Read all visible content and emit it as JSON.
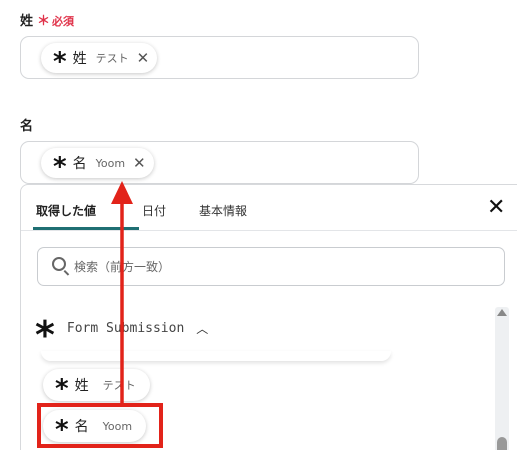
{
  "form": {
    "last_name": {
      "label": "姓",
      "required_mark": "＊",
      "required_text": "必須",
      "chip": {
        "icon": "asterisk-icon",
        "name": "姓",
        "value": "テスト"
      }
    },
    "first_name": {
      "label": "名",
      "chip": {
        "icon": "asterisk-icon",
        "name": "名",
        "value": "Yoom"
      }
    }
  },
  "dropdown": {
    "tabs": [
      {
        "label": "取得した値",
        "active": true
      },
      {
        "label": "日付",
        "active": false
      },
      {
        "label": "基本情報",
        "active": false
      }
    ],
    "search": {
      "placeholder": "検索（前方一致）",
      "value": ""
    },
    "group": {
      "icon": "asterisk-icon",
      "title": "Form Submission",
      "expanded": true
    },
    "items": [
      {
        "icon": "asterisk-icon",
        "name": "姓",
        "value": "テスト"
      },
      {
        "icon": "asterisk-icon",
        "name": "名",
        "value": "Yoom"
      }
    ]
  },
  "colors": {
    "required": "#e0334a",
    "tab_active_underline": "#1f6f73",
    "annotation": "#e2231a"
  }
}
